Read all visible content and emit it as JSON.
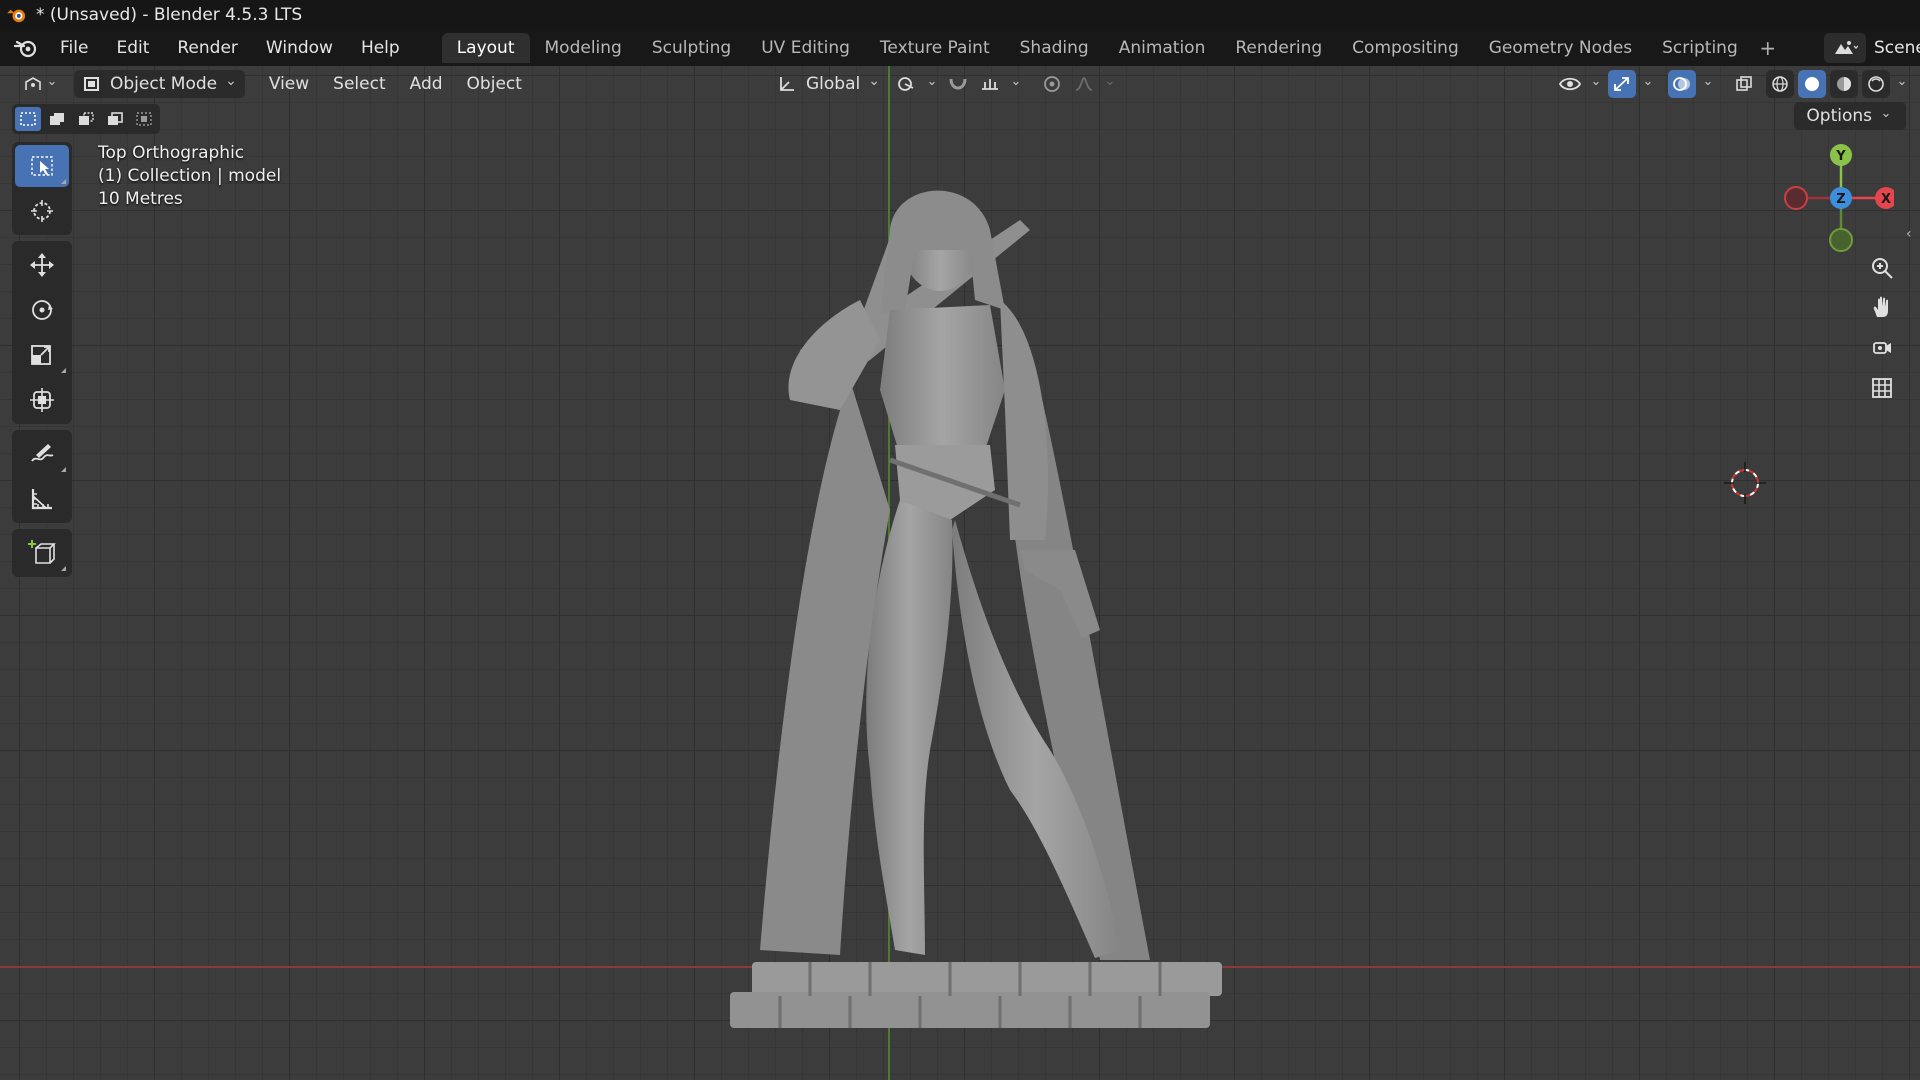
{
  "window": {
    "title": "* (Unsaved) - Blender 4.5.3 LTS"
  },
  "menus": {
    "items": [
      "File",
      "Edit",
      "Render",
      "Window",
      "Help"
    ]
  },
  "workspaces": {
    "tabs": [
      "Layout",
      "Modeling",
      "Sculpting",
      "UV Editing",
      "Texture Paint",
      "Shading",
      "Animation",
      "Rendering",
      "Compositing",
      "Geometry Nodes",
      "Scripting"
    ],
    "active": "Layout",
    "add_label": "+"
  },
  "scene": {
    "label": "Scene"
  },
  "viewport_header": {
    "mode": "Object Mode",
    "menus": [
      "View",
      "Select",
      "Add",
      "Object"
    ],
    "transform_orientation": "Global",
    "options_label": "Options"
  },
  "viewport_overlay": {
    "view_name": "Top Orthographic",
    "collection_line": "(1) Collection | model",
    "scale": "10 Metres"
  },
  "gizmo": {
    "x_label": "X",
    "y_label": "Y",
    "z_label": "Z"
  },
  "colors": {
    "accent": "#4772b3",
    "axis_x": "#e3464d",
    "axis_y": "#8bc34a",
    "axis_z": "#3e8ede",
    "model": "#9a9a9a"
  },
  "toolbar": {
    "tools": [
      "select-box",
      "cursor",
      "move",
      "rotate",
      "scale",
      "transform",
      "annotate",
      "measure",
      "add-cube"
    ],
    "active": "select-box"
  }
}
